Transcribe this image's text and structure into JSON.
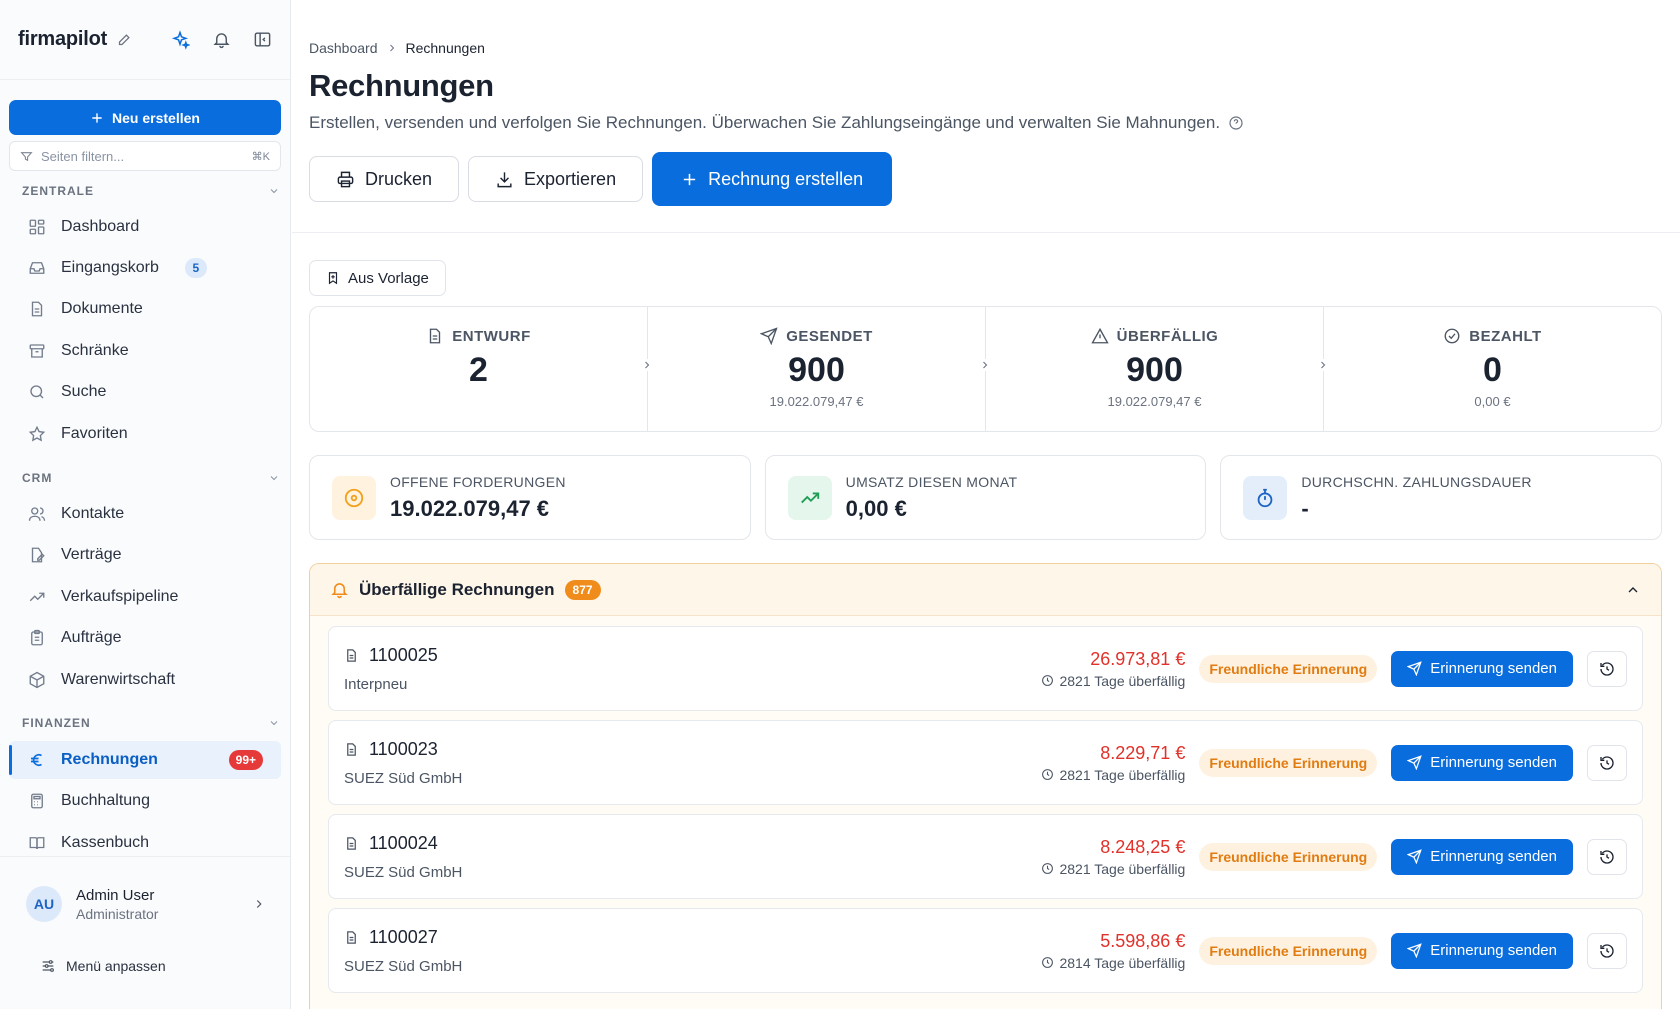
{
  "app": {
    "brand": "firmapilot"
  },
  "sidebar": {
    "new_button": "Neu erstellen",
    "filter_placeholder": "Seiten filtern...",
    "filter_shortcut": "⌘K",
    "sections": {
      "zentrale": "ZENTRALE",
      "crm": "CRM",
      "finanzen": "FINANZEN"
    },
    "items": [
      {
        "label": "Dashboard",
        "icon": "grid-icon"
      },
      {
        "label": "Eingangskorb",
        "icon": "inbox-icon",
        "count": "5"
      },
      {
        "label": "Dokumente",
        "icon": "document-icon"
      },
      {
        "label": "Schränke",
        "icon": "archive-icon"
      },
      {
        "label": "Suche",
        "icon": "search-icon"
      },
      {
        "label": "Favoriten",
        "icon": "star-icon"
      },
      {
        "label": "Kontakte",
        "icon": "users-icon"
      },
      {
        "label": "Verträge",
        "icon": "contract-icon"
      },
      {
        "label": "Verkaufspipeline",
        "icon": "trend-icon"
      },
      {
        "label": "Aufträge",
        "icon": "clipboard-icon"
      },
      {
        "label": "Warenwirtschaft",
        "icon": "package-icon"
      },
      {
        "label": "Rechnungen",
        "icon": "euro-icon",
        "badge": "99+"
      },
      {
        "label": "Buchhaltung",
        "icon": "calculator-icon"
      },
      {
        "label": "Kassenbuch",
        "icon": "book-icon"
      }
    ],
    "user": {
      "initials": "AU",
      "name": "Admin User",
      "role": "Administrator"
    },
    "menu_adjust": "Menü anpassen"
  },
  "header": {
    "breadcrumb": [
      "Dashboard",
      "Rechnungen"
    ],
    "title": "Rechnungen",
    "subtitle": "Erstellen, versenden und verfolgen Sie Rechnungen. Überwachen Sie Zahlungseingänge und verwalten Sie Mahnungen.",
    "actions": {
      "print": "Drucken",
      "export": "Exportieren",
      "create": "Rechnung erstellen"
    }
  },
  "template_button": "Aus Vorlage",
  "status": [
    {
      "label": "ENTWURF",
      "value": "2",
      "sub": "",
      "icon": "file-icon"
    },
    {
      "label": "GESENDET",
      "value": "900",
      "sub": "19.022.079,47 €",
      "icon": "send-icon"
    },
    {
      "label": "ÜBERFÄLLIG",
      "value": "900",
      "sub": "19.022.079,47 €",
      "icon": "warning-icon"
    },
    {
      "label": "BEZAHLT",
      "value": "0",
      "sub": "0,00 €",
      "icon": "check-circle-icon"
    }
  ],
  "kpis": [
    {
      "label": "OFFENE FORDERUNGEN",
      "value": "19.022.079,47 €",
      "icon": "coin-icon",
      "color": "#f2a11d"
    },
    {
      "label": "UMSATZ DIESEN MONAT",
      "value": "0,00 €",
      "icon": "trending-up-icon",
      "color": "#1f9d55"
    },
    {
      "label": "DURCHSCHN. ZAHLUNGSDAUER",
      "value": "-",
      "icon": "stopwatch-icon",
      "color": "#1d64c2"
    }
  ],
  "overdue": {
    "title": "Überfällige Rechnungen",
    "count": "877",
    "reminder_label": "Freundliche Erinnerung",
    "send_label": "Erinnerung senden",
    "rows": [
      {
        "number": "1100025",
        "client": "Interpneu",
        "amount": "26.973,81 €",
        "days": "2821 Tage überfällig"
      },
      {
        "number": "1100023",
        "client": "SUEZ Süd GmbH",
        "amount": "8.229,71 €",
        "days": "2821 Tage überfällig"
      },
      {
        "number": "1100024",
        "client": "SUEZ Süd GmbH",
        "amount": "8.248,25 €",
        "days": "2821 Tage überfällig"
      },
      {
        "number": "1100027",
        "client": "SUEZ Süd GmbH",
        "amount": "5.598,86 €",
        "days": "2814 Tage überfällig"
      }
    ]
  },
  "colors": {
    "primary": "#0a6ddd",
    "danger": "#e0312a",
    "warning": "#f08c1b"
  }
}
